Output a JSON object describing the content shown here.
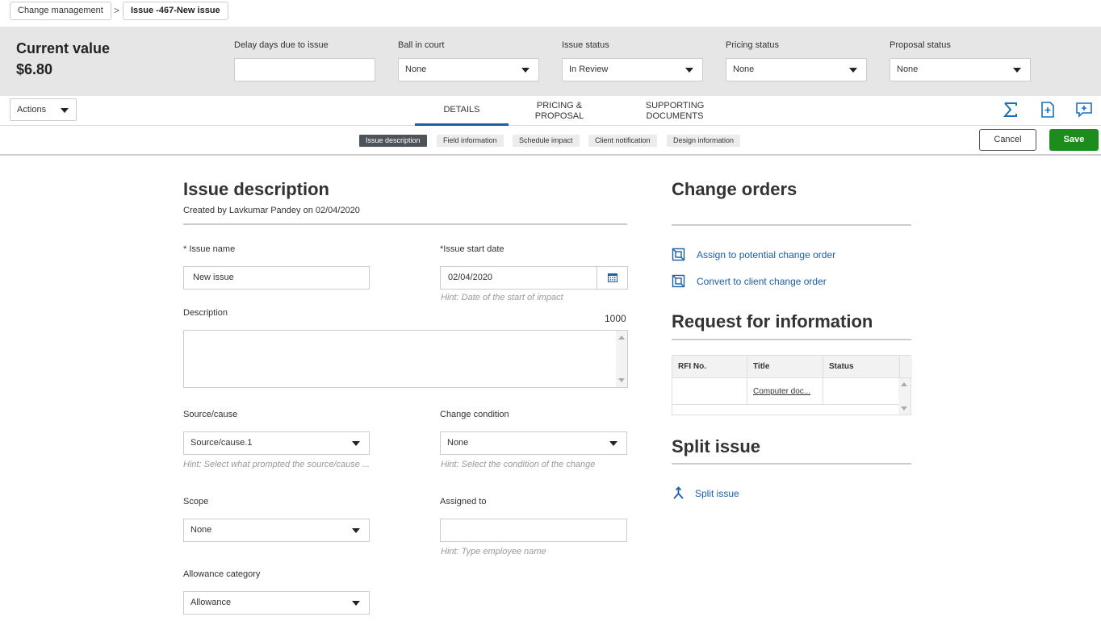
{
  "breadcrumb": {
    "items": [
      "Change management",
      "Issue -467-New issue"
    ],
    "separator": ">"
  },
  "header": {
    "current_value_label": "Current value",
    "current_value": "$6.80",
    "fields": [
      {
        "label": "Delay days due to issue",
        "value": ""
      },
      {
        "label": "Ball in court",
        "value": "None"
      },
      {
        "label": "Issue status",
        "value": "In Review"
      },
      {
        "label": "Pricing status",
        "value": "None"
      },
      {
        "label": "Proposal status",
        "value": "None"
      }
    ]
  },
  "toolbar": {
    "actions_label": "Actions",
    "tabs": [
      {
        "line1": "DETAILS",
        "line2": ""
      },
      {
        "line1": "PRICING &",
        "line2": "PROPOSAL"
      },
      {
        "line1": "SUPPORTING",
        "line2": "DOCUMENTS"
      }
    ],
    "icons": [
      "sigma-icon",
      "add-note-icon",
      "add-comment-icon"
    ]
  },
  "subnav": {
    "pills": [
      "Issue description",
      "Field information",
      "Schedule impact",
      "Client notification",
      "Design information"
    ],
    "cancel_label": "Cancel",
    "save_label": "Save"
  },
  "issue": {
    "title": "Issue description",
    "created_by": "Created by Lavkumar Pandey on 02/04/2020",
    "issue_name_label": "* Issue name",
    "issue_name_value": "New issue",
    "start_date_label": "*Issue start date",
    "start_date_value": "02/04/2020",
    "start_date_hint": "Hint: Date of the start of impact",
    "description_label": "Description",
    "description_count": "1000",
    "source_label": "Source/cause",
    "source_value": "Source/cause.1",
    "source_hint": "Hint: Select what prompted the source/cause ...",
    "condition_label": "Change condition",
    "condition_value": "None",
    "condition_hint": "Hint: Select the condition of the change",
    "scope_label": "Scope",
    "scope_value": "None",
    "assigned_label": "Assigned to",
    "assigned_value": "",
    "assigned_hint": "Hint: Type employee name",
    "allowance_label": "Allowance category",
    "allowance_value": "Allowance"
  },
  "change_orders": {
    "title": "Change orders",
    "links": [
      "Assign to potential change order",
      "Convert to client change order"
    ]
  },
  "rfi": {
    "title": "Request for information",
    "columns": [
      "RFI No.",
      "Title",
      "Status"
    ],
    "rows": [
      [
        "",
        "Computer doc...",
        ""
      ]
    ]
  },
  "split": {
    "title": "Split issue",
    "link": "Split issue"
  },
  "colors": {
    "accent": "#1a5ea8",
    "save": "#1c8c1c",
    "header_bg": "#e6e6e6"
  }
}
